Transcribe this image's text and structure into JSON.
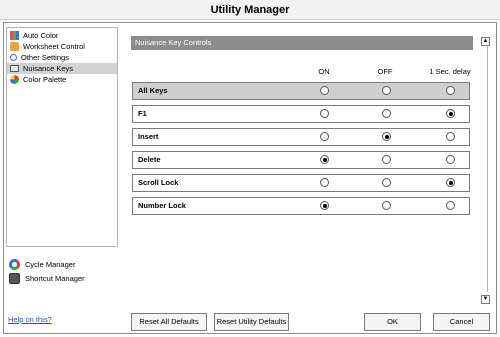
{
  "window": {
    "title": "Utility Manager"
  },
  "sidebar": {
    "items": [
      {
        "label": "Auto Color",
        "icon": "auto-color-icon",
        "selected": false
      },
      {
        "label": "Worksheet Control",
        "icon": "worksheet-control-icon",
        "selected": false
      },
      {
        "label": "Other Settings",
        "icon": "magnifier-icon",
        "selected": false
      },
      {
        "label": "Nuisance Keys",
        "icon": "keyboard-icon",
        "selected": true
      },
      {
        "label": "Color Palette",
        "icon": "color-palette-icon",
        "selected": false
      }
    ]
  },
  "tools": {
    "cycle_manager": "Cycle Manager",
    "shortcut_manager": "Shortcut Manager"
  },
  "help_link": "Help on this?",
  "panel": {
    "title": "Nuisance Key Controls",
    "columns": [
      "ON",
      "OFF",
      "1 Sec. delay"
    ],
    "rows": [
      {
        "label": "All Keys",
        "selected": null
      },
      {
        "label": "F1",
        "selected": 2
      },
      {
        "label": "Insert",
        "selected": 1
      },
      {
        "label": "Delete",
        "selected": 0
      },
      {
        "label": "Scroll Lock",
        "selected": 2
      },
      {
        "label": "Number Lock",
        "selected": 0
      }
    ]
  },
  "buttons": {
    "reset_all": "Reset All Defaults",
    "reset_utility": "Reset Utility Defaults",
    "ok": "OK",
    "cancel": "Cancel"
  }
}
